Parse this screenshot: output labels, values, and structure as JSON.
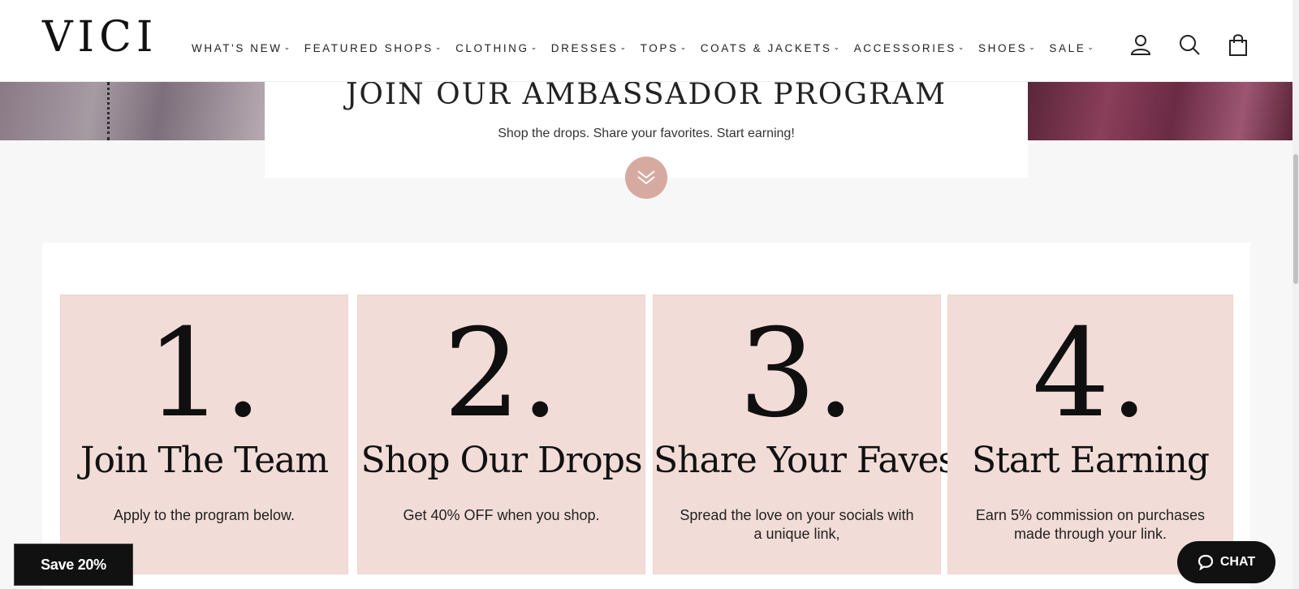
{
  "header": {
    "logo": "VICI",
    "nav": [
      {
        "label": "WHAT'S NEW",
        "icon": "chevron-down-icon"
      },
      {
        "label": "FEATURED SHOPS",
        "icon": "chevron-down-icon"
      },
      {
        "label": "CLOTHING",
        "icon": "chevron-down-icon"
      },
      {
        "label": "DRESSES",
        "icon": "chevron-down-icon"
      },
      {
        "label": "TOPS",
        "icon": "chevron-down-icon"
      },
      {
        "label": "COATS & JACKETS",
        "icon": "chevron-down-icon"
      },
      {
        "label": "ACCESSORIES",
        "icon": "chevron-down-icon"
      },
      {
        "label": "SHOES",
        "icon": "chevron-down-icon"
      },
      {
        "label": "SALE",
        "icon": "chevron-down-icon"
      }
    ],
    "icons": [
      "account-icon",
      "search-icon",
      "cart-icon"
    ]
  },
  "promo": {
    "title": "JOIN OUR AMBASSADOR PROGRAM",
    "subtitle": "Shop the drops. Share your favorites. Start earning!",
    "scroll_icon": "double-chevron-down-icon",
    "accent_color": "#d6aaa1"
  },
  "steps": [
    {
      "number": "1.",
      "title": "Join The Team",
      "description": "Apply to the program below."
    },
    {
      "number": "2.",
      "title": "Shop Our Drops",
      "description": "Get 40% OFF when you shop."
    },
    {
      "number": "3.",
      "title": "Share Your Faves",
      "description": "Spread the love on your socials with a unique link,"
    },
    {
      "number": "4.",
      "title": "Start Earning",
      "description": "Earn 5% commission on purchases made through your link."
    }
  ],
  "card_color": "#f2dcd7",
  "save_button": {
    "label": "Save 20%"
  },
  "chat_button": {
    "label": "CHAT",
    "icon": "chat-bubble-icon"
  }
}
